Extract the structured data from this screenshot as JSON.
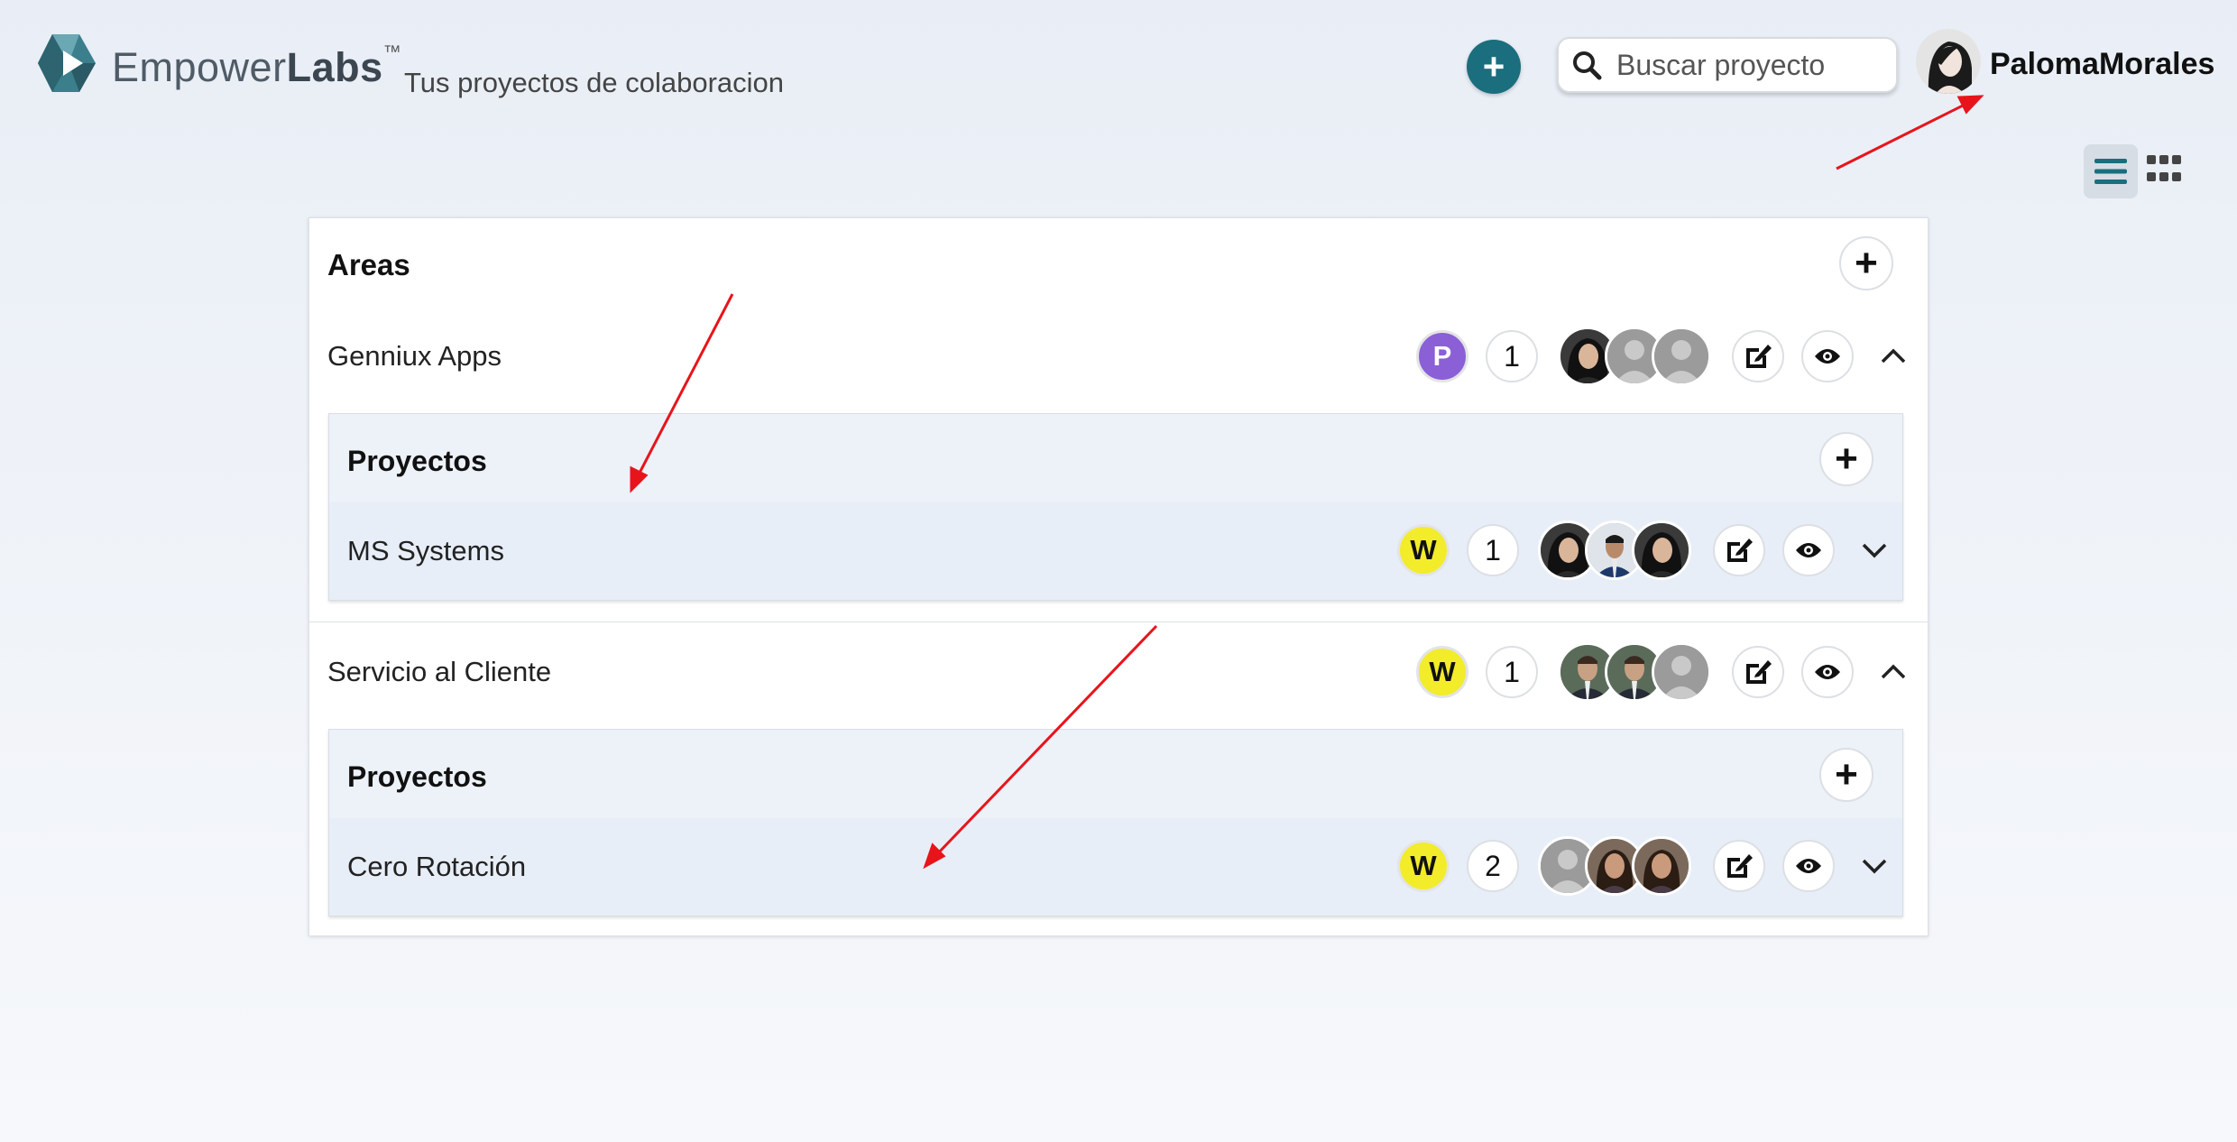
{
  "header": {
    "brand_empower": "Empower",
    "brand_labs": "Labs",
    "brand_tm": "™",
    "subtitle": "Tus proyectos de colaboracion",
    "search_placeholder": "Buscar proyecto",
    "username": "PalomaMorales",
    "add_label": "+"
  },
  "areas": {
    "title": "Areas",
    "add_label": "+",
    "items": [
      {
        "name": "Genniux Apps",
        "badge_letter": "P",
        "badge_color": "#8b5fd6",
        "count": "1",
        "expanded": true,
        "projects_title": "Proyectos",
        "projects_add_label": "+",
        "projects": [
          {
            "name": "MS Systems",
            "badge_letter": "W",
            "badge_color": "#f2ec2a",
            "count": "1"
          }
        ]
      },
      {
        "name": "Servicio al Cliente",
        "badge_letter": "W",
        "badge_color": "#f2ec2a",
        "count": "1",
        "expanded": true,
        "projects_title": "Proyectos",
        "projects_add_label": "+",
        "projects": [
          {
            "name": "Cero Rotación",
            "badge_letter": "W",
            "badge_color": "#f2ec2a",
            "count": "2"
          }
        ]
      }
    ]
  },
  "colors": {
    "accent": "#1a6e7e",
    "annotation_arrow": "#e8141b"
  },
  "icons": [
    "logo-icon",
    "search-icon",
    "edit-icon",
    "eye-icon",
    "chevron-up-icon",
    "chevron-down-icon",
    "list-view-icon",
    "grid-view-icon"
  ]
}
